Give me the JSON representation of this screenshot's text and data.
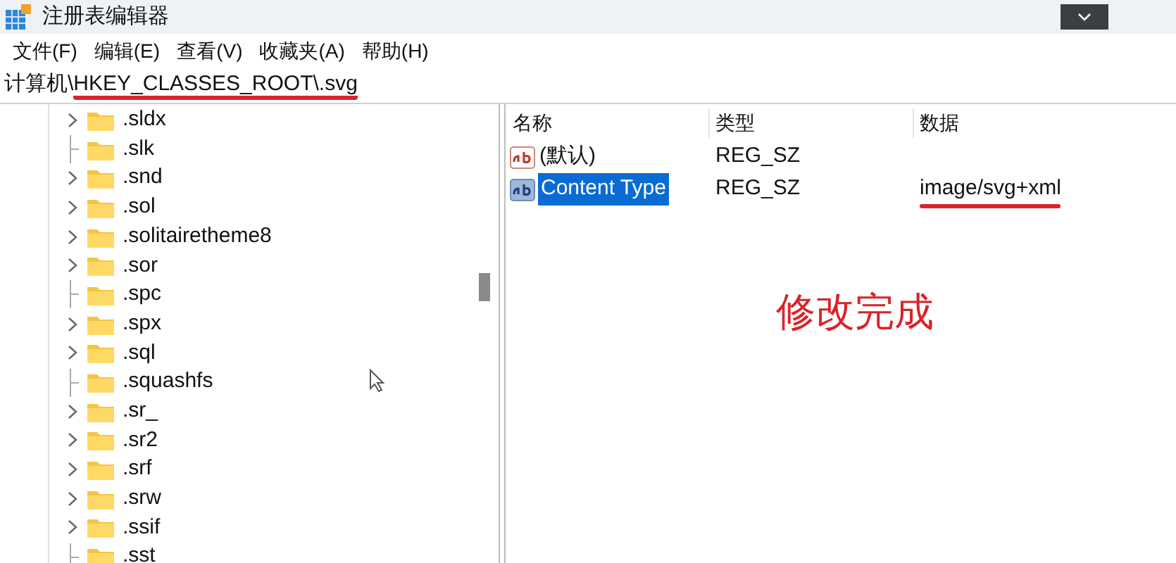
{
  "window": {
    "title": "注册表编辑器"
  },
  "menu": [
    "文件(F)",
    "编辑(E)",
    "查看(V)",
    "收藏夹(A)",
    "帮助(H)"
  ],
  "address": {
    "prefix": "计算机\\",
    "highlighted": "HKEY_CLASSES_ROOT\\.svg"
  },
  "tree": [
    {
      "label": ".sldx",
      "has_children": true
    },
    {
      "label": ".slk",
      "has_children": false
    },
    {
      "label": ".snd",
      "has_children": true
    },
    {
      "label": ".sol",
      "has_children": true
    },
    {
      "label": ".solitairetheme8",
      "has_children": true
    },
    {
      "label": ".sor",
      "has_children": true
    },
    {
      "label": ".spc",
      "has_children": false
    },
    {
      "label": ".spx",
      "has_children": true
    },
    {
      "label": ".sql",
      "has_children": true
    },
    {
      "label": ".squashfs",
      "has_children": false
    },
    {
      "label": ".sr_",
      "has_children": true
    },
    {
      "label": ".sr2",
      "has_children": true
    },
    {
      "label": ".srf",
      "has_children": true
    },
    {
      "label": ".srw",
      "has_children": true
    },
    {
      "label": ".ssif",
      "has_children": true
    },
    {
      "label": ".sst",
      "has_children": false
    }
  ],
  "table": {
    "columns": [
      "名称",
      "类型",
      "数据"
    ],
    "rows": [
      {
        "name": "(默认)",
        "type": "REG_SZ",
        "data": "",
        "selected": false,
        "underlined": false
      },
      {
        "name": "Content Type",
        "type": "REG_SZ",
        "data": "image/svg+xml",
        "selected": true,
        "underlined": true
      }
    ]
  },
  "annotation": "修改完成"
}
